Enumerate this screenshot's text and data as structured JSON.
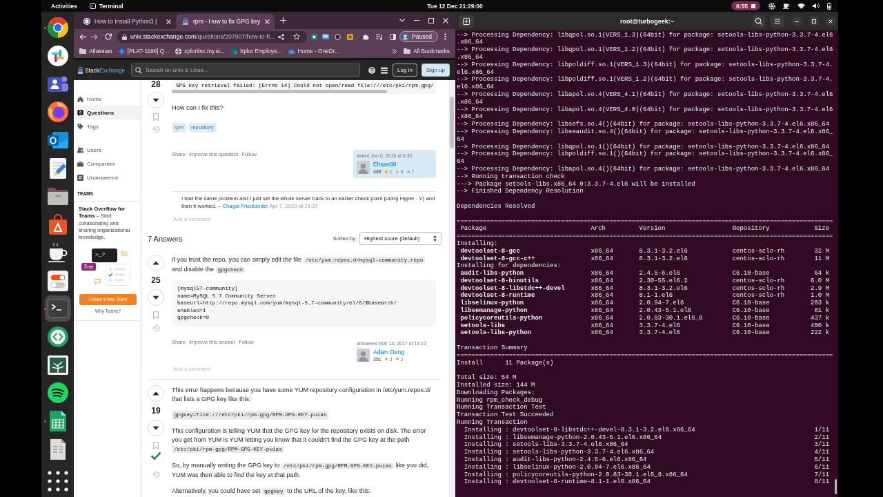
{
  "top_bar": {
    "activities": "Activities",
    "app": "Terminal",
    "clock": "Tue 12 Dec 21:29:00",
    "recording": "6:55"
  },
  "dock": [
    {
      "kind": "ring",
      "running": true,
      "selected": false
    },
    {
      "kind": "pinwheel",
      "running": false,
      "selected": false
    },
    {
      "kind": "people",
      "running": false,
      "selected": false
    },
    {
      "kind": "flame",
      "running": false,
      "selected": false
    },
    {
      "kind": "envelope",
      "running": false,
      "selected": false
    },
    {
      "kind": "pencil",
      "running": false,
      "selected": false
    },
    {
      "kind": "folder",
      "running": false,
      "selected": false
    },
    {
      "kind": "bag",
      "running": false,
      "selected": false
    },
    {
      "kind": "cup",
      "running": false,
      "selected": false
    },
    {
      "kind": "toggles",
      "running": false,
      "selected": false
    },
    {
      "kind": "terminal",
      "running": true,
      "selected": true
    },
    {
      "kind": "arrows",
      "running": false,
      "selected": false
    },
    {
      "kind": "tree",
      "running": false,
      "selected": false
    },
    {
      "kind": "waves",
      "running": false,
      "selected": false
    },
    {
      "kind": "sheet",
      "running": true,
      "selected": false
    },
    {
      "kind": "document",
      "running": false,
      "selected": false
    },
    {
      "kind": "grid",
      "running": false,
      "selected": false
    }
  ],
  "browser": {
    "tabs": [
      {
        "kind": "circle",
        "title": "How to Install Python3 (",
        "selected": false
      },
      {
        "kind": "stack",
        "title": "rpm - How to fix GPG key",
        "selected": true
      }
    ],
    "address": {
      "host": "unix.stackexchange.com",
      "path": "/questions/207907/how-to-fi..."
    },
    "profile": "Paused",
    "bookmarks": [
      {
        "kind": "folder",
        "label": "Atlassian"
      },
      {
        "kind": "diamond",
        "label": "[PLAT-1196] Q..."
      },
      {
        "kind": "globe",
        "label": "xploritsc.my.si..."
      },
      {
        "kind": "circles",
        "label": "Xplor Employe..."
      },
      {
        "kind": "cloud",
        "label": "Home - OneDr..."
      }
    ],
    "all_bookmarks": "All Bookmarks"
  },
  "site": {
    "logo": {
      "main": "Stack",
      "accent": "Exchange"
    },
    "search": {
      "placeholder": "Search on Unix & Linux..."
    },
    "login": "Log in",
    "signup": "Sign up",
    "nav": [
      [
        {
          "kind": "home",
          "label": "Home",
          "selected": false
        },
        {
          "kind": "questions",
          "label": "Questions",
          "selected": true
        },
        {
          "kind": "tags",
          "label": "Tags",
          "selected": false
        }
      ],
      [
        {
          "kind": "users",
          "label": "Users",
          "selected": false
        },
        {
          "kind": "companies",
          "label": "Companies",
          "selected": false
        },
        {
          "kind": "unanswered",
          "label": "Unanswered",
          "selected": false
        }
      ]
    ],
    "teams": {
      "heading": "TEAMS",
      "promo": "**Stack Overflow for Teams** – Start collaborating and sharing organizational knowledge.",
      "prompt": ">_?",
      "badge": "Free",
      "button": "Create a free Team",
      "link": "Why Teams?"
    },
    "question": {
      "votes": "28",
      "code": "GPG key retrieval failed: [Errno 14] Could not open/read file:///etc/pki/rpm-gpg/",
      "body": "How can I fix this?",
      "tags": [
        "rpm",
        "repository"
      ],
      "actions": [
        "Share",
        "Improve this question",
        "Follow"
      ],
      "author": {
        "action": "asked Jun 6, 2015 at 6:30",
        "name": "Ehsan88",
        "reputation": "468",
        "highlighted": true,
        "badges": [
          {
            "count": "1",
            "color": "#f1b600"
          },
          {
            "count": "4",
            "color": "#b4b8bc"
          },
          {
            "count": "7",
            "color": "#d1a684"
          }
        ]
      },
      "comments": [
        {
          "text": "I had the same problem and I just set the whole server back to an earlier check point (using Hyper - V) and then it worked. –",
          "user": "Chagai Friedlander",
          "date": "Apr 7, 2020 at 21:37"
        }
      ],
      "add_comment": "Add a comment"
    },
    "answers_header": {
      "count": "7 Answers",
      "sort_label": "Sorted by:",
      "sort_value": "Highest score (default)"
    },
    "answers": [
      {
        "votes": "25",
        "accepted": false,
        "body": [
          {
            "kind": "paragraph",
            "parts": [
              {
                "kind": "text",
                "text": "If you trust the repo, you can simply edit the file "
              },
              {
                "kind": "code",
                "text": "/etc/yum.repos.d/mysql-community.repo"
              },
              {
                "kind": "text",
                "text": " and disable the "
              },
              {
                "kind": "code",
                "text": "gpgcheck"
              }
            ]
          },
          {
            "kind": "code_block",
            "lines": [
              "[mysql57-community]",
              "name=MySQL 5.7 Community Server",
              "baseurl=http://repo.mysql.com/yum/mysql-5.7-community/el/6/$basearch/",
              "enabled=1",
              "gpgcheck=0"
            ]
          }
        ],
        "actions": [
          "Share",
          "Improve this answer",
          "Follow"
        ],
        "author": {
          "action": "answered Mar 13, 2017 at 14:13",
          "name": "Adam Deng",
          "reputation": "351",
          "highlighted": false,
          "badges": [
            {
              "count": "3",
              "color": "#b4b8bc"
            },
            {
              "count": "2",
              "color": "#d1a684"
            }
          ]
        },
        "add_comment": "Add a comment"
      },
      {
        "votes": "19",
        "accepted": true,
        "body": [
          {
            "kind": "paragraph",
            "parts": [
              {
                "kind": "text",
                "text": "This error happens because you have some YUM repository configuration in /etc/yum.repos.d/ that lists a GPG key like this:"
              }
            ]
          },
          {
            "kind": "paragraph",
            "parts": [
              {
                "kind": "code",
                "text": "gpgkey=file:///etc/pki/rpm-gpg/RPM-GPG-KEY-puias"
              }
            ]
          },
          {
            "kind": "paragraph",
            "parts": [
              {
                "kind": "text",
                "text": "This configuration is telling YUM that the GPG key for the repository exists on disk. The error you get from YUM is YUM letting you know that it couldn't find the GPG key at the path "
              },
              {
                "kind": "code",
                "text": "/etc/pki/rpm-gpg/RPM-GPG-KEY-puias"
              }
            ]
          },
          {
            "kind": "paragraph",
            "parts": [
              {
                "kind": "text",
                "text": "So, by manually writing the GPG key to "
              },
              {
                "kind": "code",
                "text": "/etc/pki/rpm-gpg/RPM-GPG-KEY-puias"
              },
              {
                "kind": "text",
                "text": " like you did, YUM was then able to find the key at that path."
              }
            ]
          },
          {
            "kind": "paragraph",
            "parts": [
              {
                "kind": "text",
                "text": "Alternatively, you could have set "
              },
              {
                "kind": "code",
                "text": "gpgkey"
              },
              {
                "kind": "text",
                "text": " to the URL of the key, like this:"
              }
            ]
          }
        ]
      }
    ]
  },
  "terminal": {
    "title": "root@turbogeek:~",
    "lines": [
      {
        "kind": "text",
        "text": "--> Processing Dependency: libqpol.so.1(VERS_1.3)(64bit) for package: setools-libs-python-3.3.7-4.el6"
      },
      {
        "kind": "text",
        "text": ".x86_64"
      },
      {
        "kind": "text",
        "text": "--> Processing Dependency: libqpol.so.1(VERS_1.2)(64bit) for package: setools-libs-python-3.3.7-4.el6"
      },
      {
        "kind": "text",
        "text": ".x86_64"
      },
      {
        "kind": "text",
        "text": "--> Processing Dependency: libpoldiff.so.1(VERS_1.3)(64bit) for package: setools-libs-python-3.3.7-4."
      },
      {
        "kind": "text",
        "text": "el6.x86_64"
      },
      {
        "kind": "text",
        "text": "--> Processing Dependency: libpoldiff.so.1(VERS_1.2)(64bit) for package: setools-libs-python-3.3.7-4."
      },
      {
        "kind": "text",
        "text": "el6.x86_64"
      },
      {
        "kind": "text",
        "text": "--> Processing Dependency: libapol.so.4(VERS_4.1)(64bit) for package: setools-libs-python-3.3.7-4.el6"
      },
      {
        "kind": "text",
        "text": ".x86_64"
      },
      {
        "kind": "text",
        "text": "--> Processing Dependency: libapol.so.4(VERS_4.0)(64bit) for package: setools-libs-python-3.3.7-4.el6"
      },
      {
        "kind": "text",
        "text": ".x86_64"
      },
      {
        "kind": "text",
        "text": "--> Processing Dependency: libsefs.so.4()(64bit) for package: setools-libs-python-3.3.7-4.el6.x86_64"
      },
      {
        "kind": "text",
        "text": "--> Processing Dependency: libseaudit.so.4()(64bit) for package: setools-libs-python-3.3.7-4.el6.x86_"
      },
      {
        "kind": "text",
        "text": "64"
      },
      {
        "kind": "text",
        "text": "--> Processing Dependency: libqpol.so.1()(64bit) for package: setools-libs-python-3.3.7-4.el6.x86_64"
      },
      {
        "kind": "text",
        "text": "--> Processing Dependency: libpoldiff.so.1()(64bit) for package: setools-libs-python-3.3.7-4.el6.x86_"
      },
      {
        "kind": "text",
        "text": "64"
      },
      {
        "kind": "text",
        "text": "--> Processing Dependency: libapol.so.4()(64bit) for package: setools-libs-python-3.3.7-4.el6.x86_64"
      },
      {
        "kind": "text",
        "text": "--> Running transaction check"
      },
      {
        "kind": "text",
        "text": "---> Package setools-libs.x86_64 0:3.3.7-4.el6 will be installed"
      },
      {
        "kind": "text",
        "text": "--> Finished Dependency Resolution"
      },
      {
        "kind": "blank"
      },
      {
        "kind": "text",
        "text": "Dependencies Resolved"
      },
      {
        "kind": "blank"
      },
      {
        "kind": "rule",
        "text": "====================================================================================================="
      },
      {
        "kind": "header",
        "cells": [
          "Package",
          "Arch",
          "Version",
          "Repository",
          "Size"
        ]
      },
      {
        "kind": "rule",
        "text": "====================================================================================================="
      },
      {
        "kind": "section",
        "text": "Installing:"
      },
      {
        "kind": "package",
        "cells": [
          "devtoolset-8-gcc",
          "x86_64",
          "8.3.1-3.2.el6",
          "centos-sclo-rh",
          "32 M"
        ]
      },
      {
        "kind": "package",
        "cells": [
          "devtoolset-8-gcc-c++",
          "x86_64",
          "8.3.1-3.2.el6",
          "centos-sclo-rh",
          "11 M"
        ]
      },
      {
        "kind": "section",
        "text": "Installing for dependencies:"
      },
      {
        "kind": "package",
        "cells": [
          "audit-libs-python",
          "x86_64",
          "2.4.5-6.el6",
          "C6.10-base",
          "64 k"
        ]
      },
      {
        "kind": "package",
        "cells": [
          "devtoolset-8-binutils",
          "x86_64",
          "2.30-55.el6.2",
          "centos-sclo-rh",
          "6.0 M"
        ]
      },
      {
        "kind": "package",
        "cells": [
          "devtoolset-8-libstdc++-devel",
          "x86_64",
          "8.3.1-3.2.el6",
          "centos-sclo-rh",
          "2.9 M"
        ]
      },
      {
        "kind": "package",
        "cells": [
          "devtoolset-8-runtime",
          "x86_64",
          "8.1-1.el6",
          "centos-sclo-rh",
          "1.0 M"
        ]
      },
      {
        "kind": "package",
        "cells": [
          "libselinux-python",
          "x86_64",
          "2.0.94-7.el6",
          "C6.10-base",
          "203 k"
        ]
      },
      {
        "kind": "package",
        "cells": [
          "libsemanage-python",
          "x86_64",
          "2.0.43-5.1.el6",
          "C6.10-base",
          "81 k"
        ]
      },
      {
        "kind": "package",
        "cells": [
          "policycoreutils-python",
          "x86_64",
          "2.0.83-30.1.el6_8",
          "C6.10-base",
          "437 k"
        ]
      },
      {
        "kind": "package",
        "cells": [
          "setools-libs",
          "x86_64",
          "3.3.7-4.el6",
          "C6.10-base",
          "400 k"
        ]
      },
      {
        "kind": "package",
        "cells": [
          "setools-libs-python",
          "x86_64",
          "3.3.7-4.el6",
          "C6.10-base",
          "222 k"
        ]
      },
      {
        "kind": "blank"
      },
      {
        "kind": "text",
        "text": "Transaction Summary"
      },
      {
        "kind": "rule",
        "text": "====================================================================================================="
      },
      {
        "kind": "text",
        "text": "Install      11 Package(s)"
      },
      {
        "kind": "blank"
      },
      {
        "kind": "text",
        "text": "Total size: 54 M"
      },
      {
        "kind": "text",
        "text": "Installed size: 144 M"
      },
      {
        "kind": "text",
        "text": "Downloading Packages:"
      },
      {
        "kind": "text",
        "text": "Running rpm_check_debug"
      },
      {
        "kind": "text",
        "text": "Running Transaction Test"
      },
      {
        "kind": "text",
        "text": "Transaction Test Succeeded"
      },
      {
        "kind": "text",
        "text": "Running Transaction"
      },
      {
        "kind": "progress",
        "text": "Installing : devtoolset-8-libstdc++-devel-8.3.1-3.2.el6.x86_64",
        "count": "1/11"
      },
      {
        "kind": "progress",
        "text": "Installing : libsemanage-python-2.0.43-5.1.el6.x86_64",
        "count": "2/11"
      },
      {
        "kind": "progress",
        "text": "Installing : setools-libs-3.3.7-4.el6.x86_64",
        "count": "3/11"
      },
      {
        "kind": "progress",
        "text": "Installing : setools-libs-python-3.3.7-4.el6.x86_64",
        "count": "4/11"
      },
      {
        "kind": "progress",
        "text": "Installing : audit-libs-python-2.4.5-6.el6.x86_64",
        "count": "5/11"
      },
      {
        "kind": "progress",
        "text": "Installing : libselinux-python-2.0.94-7.el6.x86_64",
        "count": "6/11"
      },
      {
        "kind": "progress",
        "text": "Installing : policycoreutils-python-2.0.83-30.1.el6_8.x86_64",
        "count": "7/11"
      },
      {
        "kind": "progress",
        "text": "Installing : devtoolset-8-runtime-8.1-1.el6.x86_64",
        "count": "8/11"
      }
    ]
  }
}
